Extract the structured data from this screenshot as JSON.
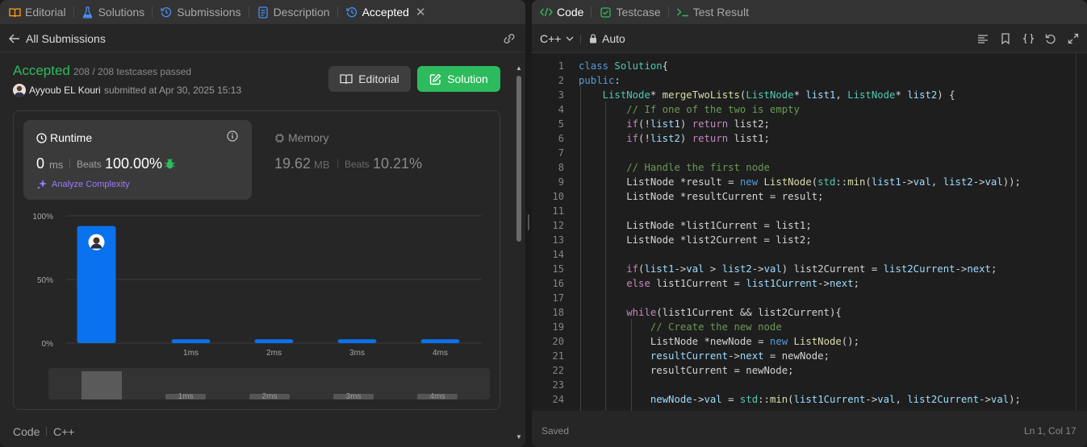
{
  "left_tabs": [
    {
      "label": "Editorial",
      "icon": "book-icon",
      "color": "#ffa116"
    },
    {
      "label": "Solutions",
      "icon": "flask-icon",
      "color": "#4a8df8"
    },
    {
      "label": "Submissions",
      "icon": "history-icon",
      "color": "#4a8df8"
    },
    {
      "label": "Description",
      "icon": "document-icon",
      "color": "#4a8df8"
    },
    {
      "label": "Accepted",
      "icon": "history-icon",
      "color": "#4a8df8"
    }
  ],
  "subbar": {
    "title": "All Submissions"
  },
  "result": {
    "status": "Accepted",
    "passed": "208 / 208 testcases passed",
    "author": "Ayyoub EL Kouri",
    "submitted": "submitted at Apr 30, 2025 15:13",
    "editorial_btn": "Editorial",
    "solution_btn": "Solution",
    "accent": "#2cbb5d"
  },
  "runtime": {
    "label": "Runtime",
    "value": "0",
    "unit": "ms",
    "beats_label": "Beats",
    "beats_value": "100.00%",
    "analyze": "Analyze Complexity"
  },
  "memory": {
    "label": "Memory",
    "value": "19.62",
    "unit": "MB",
    "beats_label": "Beats",
    "beats_value": "10.21%"
  },
  "chart_data": {
    "type": "bar",
    "categories": [
      "0ms",
      "1ms",
      "2ms",
      "3ms",
      "4ms"
    ],
    "category_labels_shown": [
      "",
      "1ms",
      "2ms",
      "3ms",
      "4ms"
    ],
    "values": [
      92,
      3,
      3,
      3,
      3
    ],
    "y_ticks": [
      "100%",
      "50%",
      "0%"
    ],
    "ylim": [
      0,
      100
    ],
    "bar_color": "#0a72ef",
    "highlight_index": 0,
    "grid": true,
    "mini_labels": [
      "1ms",
      "2ms",
      "3ms",
      "4ms"
    ]
  },
  "bottom": {
    "code_label": "Code",
    "lang_label": "C++"
  },
  "right_tabs": [
    {
      "label": "Code",
      "icon": "code-icon",
      "color": "#2cbb5d"
    },
    {
      "label": "Testcase",
      "icon": "checkbox-icon",
      "color": "#2cbb5d"
    },
    {
      "label": "Test Result",
      "icon": "terminal-icon",
      "color": "#2cbb5d"
    }
  ],
  "editor_toolbar": {
    "language": "C++",
    "mode": "Auto"
  },
  "code_lines": [
    [
      [
        "k",
        "class "
      ],
      [
        "t",
        "Solution"
      ],
      [
        "",
        "{"
      ]
    ],
    [
      [
        "k",
        "public"
      ],
      [
        "",
        ":"
      ]
    ],
    [
      [
        "",
        "    "
      ],
      [
        "t",
        "ListNode"
      ],
      [
        "",
        "* "
      ],
      [
        "f",
        "mergeTwoLists"
      ],
      [
        "",
        "("
      ],
      [
        "t",
        "ListNode"
      ],
      [
        "",
        "* "
      ],
      [
        "v",
        "list1"
      ],
      [
        "",
        ", "
      ],
      [
        "t",
        "ListNode"
      ],
      [
        "",
        "* "
      ],
      [
        "v",
        "list2"
      ],
      [
        "",
        ") {"
      ]
    ],
    [
      [
        "",
        "        "
      ],
      [
        "c",
        "// If one of the two is empty"
      ]
    ],
    [
      [
        "",
        "        "
      ],
      [
        "p",
        "if"
      ],
      [
        "",
        "(!"
      ],
      [
        "v",
        "list1"
      ],
      [
        "",
        ") "
      ],
      [
        "p",
        "return"
      ],
      [
        "",
        " list2;"
      ]
    ],
    [
      [
        "",
        "        "
      ],
      [
        "p",
        "if"
      ],
      [
        "",
        "(!"
      ],
      [
        "v",
        "list2"
      ],
      [
        "",
        ") "
      ],
      [
        "p",
        "return"
      ],
      [
        "",
        " list1;"
      ]
    ],
    [
      [
        "",
        ""
      ]
    ],
    [
      [
        "",
        "        "
      ],
      [
        "c",
        "// Handle the first node"
      ]
    ],
    [
      [
        "",
        "        ListNode *result = "
      ],
      [
        "k",
        "new "
      ],
      [
        "f",
        "ListNode"
      ],
      [
        "",
        "("
      ],
      [
        "t",
        "std"
      ],
      [
        "",
        "::"
      ],
      [
        "f",
        "min"
      ],
      [
        "",
        "("
      ],
      [
        "v",
        "list1"
      ],
      [
        "",
        "->"
      ],
      [
        "v",
        "val"
      ],
      [
        "",
        ", "
      ],
      [
        "v",
        "list2"
      ],
      [
        "",
        "->"
      ],
      [
        "v",
        "val"
      ],
      [
        "",
        "));"
      ]
    ],
    [
      [
        "",
        "        ListNode *resultCurrent = result;"
      ]
    ],
    [
      [
        "",
        ""
      ]
    ],
    [
      [
        "",
        "        ListNode *list1Current = list1;"
      ]
    ],
    [
      [
        "",
        "        ListNode *list2Current = list2;"
      ]
    ],
    [
      [
        "",
        ""
      ]
    ],
    [
      [
        "",
        "        "
      ],
      [
        "p",
        "if"
      ],
      [
        "",
        "("
      ],
      [
        "v",
        "list1"
      ],
      [
        "",
        "->"
      ],
      [
        "v",
        "val"
      ],
      [
        "",
        " > "
      ],
      [
        "v",
        "list2"
      ],
      [
        "",
        "->"
      ],
      [
        "v",
        "val"
      ],
      [
        "",
        ") list2Current = "
      ],
      [
        "v",
        "list2Current"
      ],
      [
        "",
        "->"
      ],
      [
        "v",
        "next"
      ],
      [
        "",
        ";"
      ]
    ],
    [
      [
        "",
        "        "
      ],
      [
        "p",
        "else"
      ],
      [
        "",
        " list1Current = "
      ],
      [
        "v",
        "list1Current"
      ],
      [
        "",
        "->"
      ],
      [
        "v",
        "next"
      ],
      [
        "",
        ";"
      ]
    ],
    [
      [
        "",
        ""
      ]
    ],
    [
      [
        "",
        "        "
      ],
      [
        "p",
        "while"
      ],
      [
        "",
        "(list1Current && list2Current){"
      ]
    ],
    [
      [
        "",
        "            "
      ],
      [
        "c",
        "// Create the new node"
      ]
    ],
    [
      [
        "",
        "            ListNode *newNode = "
      ],
      [
        "k",
        "new "
      ],
      [
        "f",
        "ListNode"
      ],
      [
        "",
        "();"
      ]
    ],
    [
      [
        "",
        "            "
      ],
      [
        "v",
        "resultCurrent"
      ],
      [
        "",
        "->"
      ],
      [
        "v",
        "next"
      ],
      [
        "",
        " = newNode;"
      ]
    ],
    [
      [
        "",
        "            resultCurrent = newNode;"
      ]
    ],
    [
      [
        "",
        ""
      ]
    ],
    [
      [
        "",
        "            "
      ],
      [
        "v",
        "newNode"
      ],
      [
        "",
        "->"
      ],
      [
        "v",
        "val"
      ],
      [
        "",
        " = "
      ],
      [
        "t",
        "std"
      ],
      [
        "",
        "::"
      ],
      [
        "f",
        "min"
      ],
      [
        "",
        "("
      ],
      [
        "v",
        "list1Current"
      ],
      [
        "",
        "->"
      ],
      [
        "v",
        "val"
      ],
      [
        "",
        ", "
      ],
      [
        "v",
        "list2Current"
      ],
      [
        "",
        "->"
      ],
      [
        "v",
        "val"
      ],
      [
        "",
        ");"
      ]
    ]
  ],
  "status_bar": {
    "saved": "Saved",
    "cursor": "Ln 1, Col 17"
  }
}
